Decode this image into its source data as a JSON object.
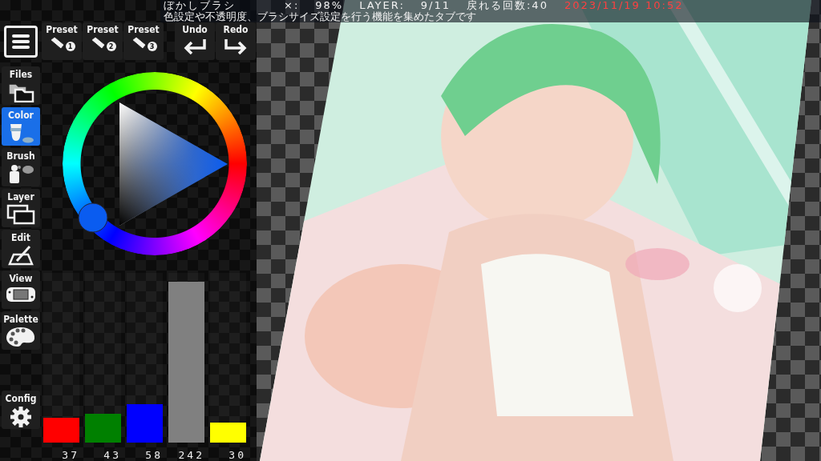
{
  "status_bar": {
    "brush": "ぼかしブラシ",
    "zoom_label": "×:",
    "zoom": "98%",
    "layer_label": "LAYER:",
    "layer": "9/11",
    "undo_count": "戻れる回数:40",
    "datetime": "2023/11/19 10:52",
    "hint": "色設定や不透明度、ブラシサイズ設定を行う機能を集めたタブです"
  },
  "toolbar": [
    {
      "label": "Preset",
      "kind": "preset",
      "badge": "1"
    },
    {
      "label": "Preset",
      "kind": "preset",
      "badge": "2"
    },
    {
      "label": "Preset",
      "kind": "preset",
      "badge": "3"
    },
    {
      "label": "Undo",
      "kind": "undo"
    },
    {
      "label": "Redo",
      "kind": "redo"
    }
  ],
  "sidebar": {
    "items": [
      {
        "label": "Files",
        "kind": "files",
        "selected": false
      },
      {
        "label": "Color",
        "kind": "color",
        "selected": true
      },
      {
        "label": "Brush",
        "kind": "brush",
        "selected": false
      },
      {
        "label": "Layer",
        "kind": "layer",
        "selected": false
      },
      {
        "label": "Edit",
        "kind": "edit",
        "selected": false
      },
      {
        "label": "View",
        "kind": "view",
        "selected": false
      },
      {
        "label": "Palette",
        "kind": "palette",
        "selected": false
      }
    ],
    "config": {
      "label": "Config",
      "kind": "config",
      "selected": false
    }
  },
  "color_picker": {
    "color": "#0a5cf0"
  },
  "channels": [
    {
      "color": "#ff0000",
      "level": 0.145,
      "reading": "37"
    },
    {
      "color": "#008000",
      "level": 0.169,
      "reading": "43"
    },
    {
      "color": "#0000ff",
      "level": 0.227,
      "reading": "58"
    },
    {
      "color": "#808080",
      "level": 0.949,
      "reading": "242"
    },
    {
      "color": "#ffff00",
      "level": 0.118,
      "reading": "30"
    }
  ]
}
